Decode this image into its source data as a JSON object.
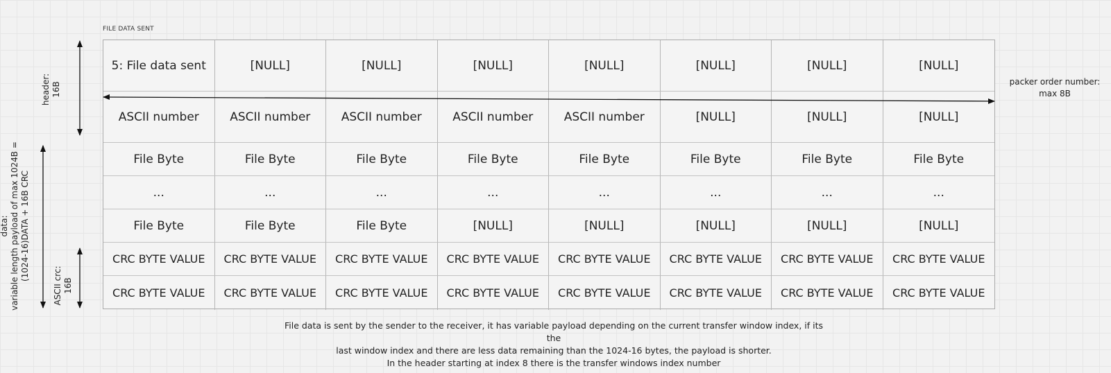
{
  "frame_title": "FILE DATA SENT",
  "table": {
    "rows": [
      [
        "5: File data sent",
        "[NULL]",
        "[NULL]",
        "[NULL]",
        "[NULL]",
        "[NULL]",
        "[NULL]",
        "[NULL]"
      ],
      [
        "ASCII number",
        "ASCII number",
        "ASCII number",
        "ASCII number",
        "ASCII number",
        "[NULL]",
        "[NULL]",
        "[NULL]"
      ],
      [
        "File Byte",
        "File Byte",
        "File Byte",
        "File Byte",
        "File Byte",
        "File Byte",
        "File Byte",
        "File Byte"
      ],
      [
        "...",
        "...",
        "...",
        "...",
        "...",
        "...",
        "...",
        "..."
      ],
      [
        "File Byte",
        "File Byte",
        "File Byte",
        "[NULL]",
        "[NULL]",
        "[NULL]",
        "[NULL]",
        "[NULL]"
      ],
      [
        "CRC BYTE VALUE",
        "CRC BYTE VALUE",
        "CRC BYTE VALUE",
        "CRC BYTE VALUE",
        "CRC BYTE VALUE",
        "CRC BYTE VALUE",
        "CRC BYTE VALUE",
        "CRC BYTE VALUE"
      ],
      [
        "CRC BYTE VALUE",
        "CRC BYTE VALUE",
        "CRC BYTE VALUE",
        "CRC BYTE VALUE",
        "CRC BYTE VALUE",
        "CRC BYTE VALUE",
        "CRC BYTE VALUE",
        "CRC BYTE VALUE"
      ]
    ]
  },
  "labels": {
    "header": [
      "header:",
      "16B"
    ],
    "data": [
      "data:",
      "variable length payload of max 1024B =",
      "(1024-16)DATA + 16B CRC"
    ],
    "crc": [
      "ASCII crc:",
      "16B"
    ],
    "packet_order": [
      "packer order number:",
      "max 8B"
    ]
  },
  "caption": [
    "File data is sent by the sender to the receiver, it has variable payload depending on the current transfer window index, if its the",
    "last window index and there are less data remaining than the 1024-16 bytes, the payload is shorter.",
    "In the header starting at index 8 there is the transfer windows index number"
  ]
}
